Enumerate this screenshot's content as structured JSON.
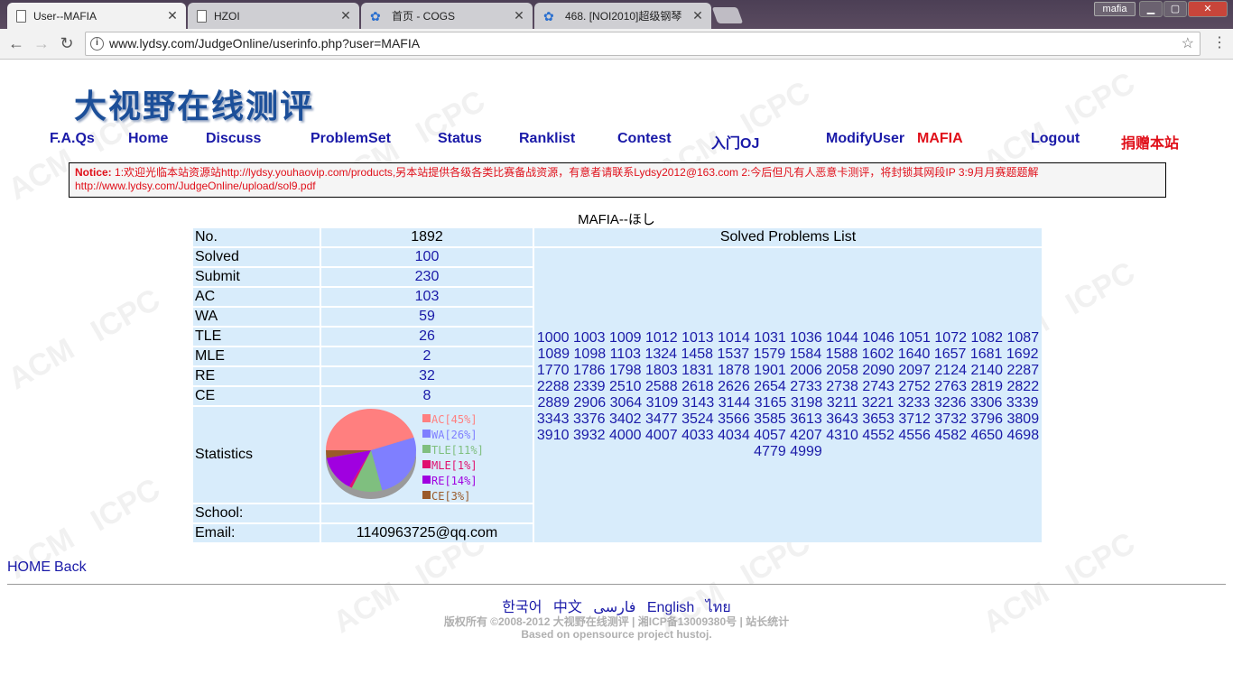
{
  "browser": {
    "tabs": [
      {
        "title": "User--MAFIA",
        "icon": "document-icon",
        "active": true
      },
      {
        "title": "HZOI",
        "icon": "document-icon",
        "active": false
      },
      {
        "title": "首页 - COGS",
        "icon": "gear-icon",
        "active": false
      },
      {
        "title": "468. [NOI2010]超级钢琴",
        "icon": "gear-icon",
        "active": false
      }
    ],
    "profile_name": "mafia",
    "url": "www.lydsy.com/JudgeOnline/userinfo.php?user=MAFIA"
  },
  "site": {
    "logo_text": "大视野在线测评",
    "nav": {
      "faqs": "F.A.Qs",
      "home": "Home",
      "discuss": "Discuss",
      "problemset": "ProblemSet",
      "status": "Status",
      "ranklist": "Ranklist",
      "contest": "Contest",
      "intro_oj": "入门OJ",
      "modify_user": "ModifyUser",
      "current_user": "MAFIA",
      "logout": "Logout",
      "donate": "捐赠本站"
    },
    "notice": {
      "label": "Notice:",
      "text": "1:欢迎光临本站资源站http://lydsy.youhaovip.com/products,另本站提供各级各类比赛备战资源，有意者请联系Lydsy2012@163.com 2:今后但凡有人恶意卡测评，将封锁其网段IP 3:9月月赛题题解",
      "link": "http://www.lydsy.com/JudgeOnline/upload/sol9.pdf"
    }
  },
  "user": {
    "title": "MAFIA--ほし",
    "rows": [
      {
        "label": "No.",
        "value": "1892",
        "link": false
      },
      {
        "label": "Solved",
        "value": "100",
        "link": true
      },
      {
        "label": "Submit",
        "value": "230",
        "link": true
      },
      {
        "label": "AC",
        "value": "103",
        "link": true
      },
      {
        "label": "WA",
        "value": "59",
        "link": true
      },
      {
        "label": "TLE",
        "value": "26",
        "link": true
      },
      {
        "label": "MLE",
        "value": "2",
        "link": true
      },
      {
        "label": "RE",
        "value": "32",
        "link": true
      },
      {
        "label": "CE",
        "value": "8",
        "link": true
      }
    ],
    "statistics_label": "Statistics",
    "school_label": "School:",
    "school_value": "",
    "email_label": "Email:",
    "email_value": "1140963725@qq.com",
    "solved_list_header": "Solved Problems List",
    "solved_problems": [
      "1000",
      "1003",
      "1009",
      "1012",
      "1013",
      "1014",
      "1031",
      "1036",
      "1044",
      "1046",
      "1051",
      "1072",
      "1082",
      "1087",
      "1089",
      "1098",
      "1103",
      "1324",
      "1458",
      "1537",
      "1579",
      "1584",
      "1588",
      "1602",
      "1640",
      "1657",
      "1681",
      "1692",
      "1770",
      "1786",
      "1798",
      "1803",
      "1831",
      "1878",
      "1901",
      "2006",
      "2058",
      "2090",
      "2097",
      "2124",
      "2140",
      "2287",
      "2288",
      "2339",
      "2510",
      "2588",
      "2618",
      "2626",
      "2654",
      "2733",
      "2738",
      "2743",
      "2752",
      "2763",
      "2819",
      "2822",
      "2889",
      "2906",
      "3064",
      "3109",
      "3143",
      "3144",
      "3165",
      "3198",
      "3211",
      "3221",
      "3233",
      "3236",
      "3306",
      "3339",
      "3343",
      "3376",
      "3402",
      "3477",
      "3524",
      "3566",
      "3585",
      "3613",
      "3643",
      "3653",
      "3712",
      "3732",
      "3796",
      "3809",
      "3910",
      "3932",
      "4000",
      "4007",
      "4033",
      "4034",
      "4057",
      "4207",
      "4310",
      "4552",
      "4556",
      "4582",
      "4650",
      "4698",
      "4779",
      "4999"
    ]
  },
  "chart_data": {
    "type": "pie",
    "slices": [
      {
        "name": "AC",
        "label": "AC[45%]",
        "percent": 45,
        "color": "#ff7f7f"
      },
      {
        "name": "WA",
        "label": "WA[26%]",
        "percent": 26,
        "color": "#7f7fff"
      },
      {
        "name": "TLE",
        "label": "TLE[11%]",
        "percent": 11,
        "color": "#7fbf7f"
      },
      {
        "name": "MLE",
        "label": "MLE[1%]",
        "percent": 1,
        "color": "#e0106f"
      },
      {
        "name": "RE",
        "label": "RE[14%]",
        "percent": 14,
        "color": "#a000e0"
      },
      {
        "name": "CE",
        "label": "CE[3%]",
        "percent": 3,
        "color": "#9a5a2a"
      }
    ]
  },
  "footer": {
    "home_link": "HOME",
    "back_link": "Back",
    "languages": [
      "한국어",
      "中文",
      "فارسی",
      "English",
      "ไทย"
    ],
    "copyright": "版权所有 ©2008-2012 大视野在线测评 | 湘ICP备13009380号 | 站长统计",
    "powered": "Based on opensource project hustoj."
  }
}
